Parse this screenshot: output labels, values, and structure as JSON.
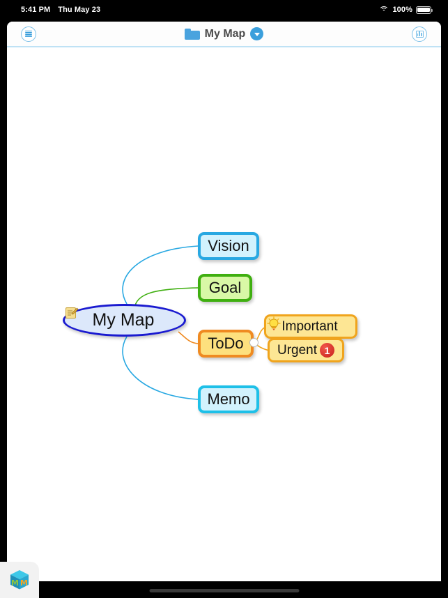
{
  "statusbar": {
    "time": "5:41 PM",
    "date": "Thu May 23",
    "wifi_icon": "wifi-icon",
    "battery_percent": "100%",
    "battery_icon": "battery-full-icon"
  },
  "toolbar": {
    "menu_icon": "list-menu-icon",
    "folder_icon": "folder-icon",
    "title": "My Map",
    "dropdown_icon": "chevron-down-icon",
    "grid_icon": "grid-view-icon"
  },
  "mindmap": {
    "root": {
      "label": "My Map",
      "emoji": "memo-icon",
      "fill": "#dce8fb",
      "stroke": "#1a1ad0"
    },
    "branches": [
      {
        "label": "Vision",
        "fill": "#d2f2fd",
        "stroke": "#28a8e2"
      },
      {
        "label": "Goal",
        "fill": "#d9f8a6",
        "stroke": "#3faf10"
      },
      {
        "label": "ToDo",
        "fill": "#fde07e",
        "stroke": "#ef8a21"
      },
      {
        "label": "Memo",
        "fill": "#d2f2fd",
        "stroke": "#1ec0e8"
      }
    ],
    "todo_children": [
      {
        "label": "Important",
        "emoji": "light-bulb-icon",
        "fill": "#fde694",
        "stroke": "#f0a41d"
      },
      {
        "label": "Urgent",
        "badge": "1",
        "fill": "#fde694",
        "stroke": "#f0a41d"
      }
    ]
  },
  "dock": {
    "app_icon": "mindmap-app-icon"
  }
}
